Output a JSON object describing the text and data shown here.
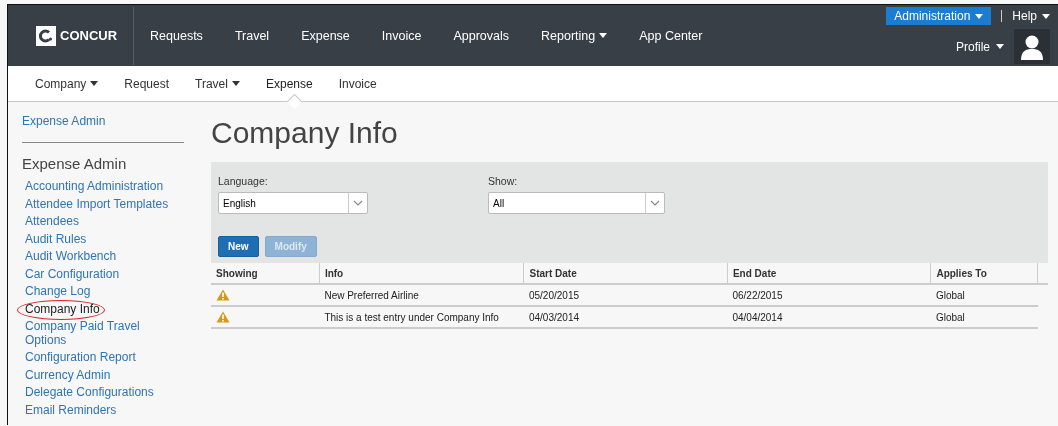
{
  "top_nav": {
    "logo": "CONCUR",
    "items": [
      {
        "label": "Requests",
        "dropdown": false
      },
      {
        "label": "Travel",
        "dropdown": false
      },
      {
        "label": "Expense",
        "dropdown": false
      },
      {
        "label": "Invoice",
        "dropdown": false
      },
      {
        "label": "Approvals",
        "dropdown": false
      },
      {
        "label": "Reporting",
        "dropdown": true
      },
      {
        "label": "App Center",
        "dropdown": false
      }
    ],
    "administration": "Administration",
    "help": "Help",
    "profile": "Profile"
  },
  "sub_nav": [
    {
      "label": "Company",
      "dropdown": true,
      "selected": false
    },
    {
      "label": "Request",
      "dropdown": false,
      "selected": false
    },
    {
      "label": "Travel",
      "dropdown": true,
      "selected": false
    },
    {
      "label": "Expense",
      "dropdown": false,
      "selected": true
    },
    {
      "label": "Invoice",
      "dropdown": false,
      "selected": false
    }
  ],
  "sidebar": {
    "breadcrumb": "Expense Admin",
    "heading": "Expense Admin",
    "items": [
      {
        "label": "Accounting Administration",
        "selected": false
      },
      {
        "label": "Attendee Import Templates",
        "selected": false
      },
      {
        "label": "Attendees",
        "selected": false
      },
      {
        "label": "Audit Rules",
        "selected": false
      },
      {
        "label": "Audit Workbench",
        "selected": false
      },
      {
        "label": "Car Configuration",
        "selected": false
      },
      {
        "label": "Change Log",
        "selected": false
      },
      {
        "label": "Company Info",
        "selected": true
      },
      {
        "label": "Company Paid Travel Options",
        "selected": false
      },
      {
        "label": "Configuration Report",
        "selected": false
      },
      {
        "label": "Currency Admin",
        "selected": false
      },
      {
        "label": "Delegate Configurations",
        "selected": false
      },
      {
        "label": "Email Reminders",
        "selected": false
      }
    ]
  },
  "page_title": "Company Info",
  "filters": [
    {
      "label": "Language:",
      "value": "English"
    },
    {
      "label": "Show:",
      "value": "All"
    }
  ],
  "buttons": [
    {
      "label": "New",
      "disabled": false
    },
    {
      "label": "Modify",
      "disabled": true
    }
  ],
  "table": {
    "columns": [
      "Showing",
      "Info",
      "Start Date",
      "End Date",
      "Applies To"
    ],
    "rows": [
      {
        "warning": true,
        "info": "New Preferred Airline",
        "start_date": "05/20/2015",
        "end_date": "06/22/2015",
        "applies_to": "Global"
      },
      {
        "warning": true,
        "info": "This is a test entry under Company Info",
        "start_date": "04/03/2014",
        "end_date": "04/04/2014",
        "applies_to": "Global"
      }
    ]
  }
}
